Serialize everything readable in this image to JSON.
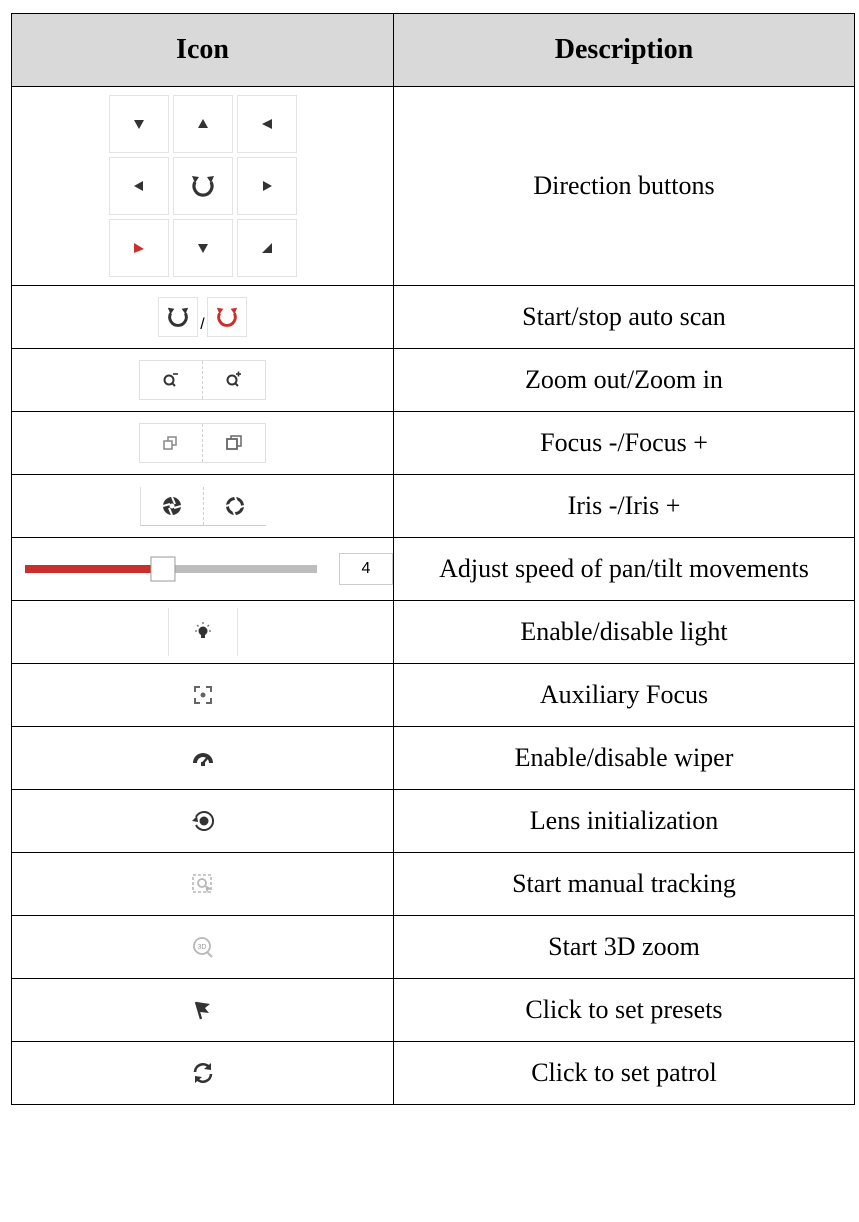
{
  "header": {
    "icon": "Icon",
    "description": "Description"
  },
  "rows": [
    {
      "description": "Direction buttons",
      "icon": "direction-pad-icon"
    },
    {
      "description": "Start/stop auto scan",
      "icon": "auto-scan-icon",
      "separator": "/"
    },
    {
      "description": "Zoom out/Zoom in",
      "icon": "zoom-icon"
    },
    {
      "description": "Focus -/Focus +",
      "icon": "focus-icon"
    },
    {
      "description": "Iris -/Iris +",
      "icon": "iris-icon"
    },
    {
      "description": "Adjust speed of pan/tilt movements",
      "icon": "speed-slider",
      "speed_value": "4",
      "slider_fraction": 0.47
    },
    {
      "description": "Enable/disable light",
      "icon": "light-icon"
    },
    {
      "description": "Auxiliary Focus",
      "icon": "auxiliary-focus-icon"
    },
    {
      "description": "Enable/disable wiper",
      "icon": "wiper-icon"
    },
    {
      "description": "Lens initialization",
      "icon": "lens-init-icon"
    },
    {
      "description": "Start manual tracking",
      "icon": "manual-tracking-icon"
    },
    {
      "description": "Start 3D zoom",
      "icon": "zoom-3d-icon",
      "badge": "3D"
    },
    {
      "description": "Click to set presets",
      "icon": "preset-flag-icon"
    },
    {
      "description": "Click to set patrol",
      "icon": "patrol-icon"
    }
  ],
  "colors": {
    "accent_red": "#c9302c",
    "icon_dark": "#333333",
    "icon_light": "#b8b8b8",
    "header_bg": "#d9d9d9",
    "slider_track": "#bdbdbd"
  }
}
